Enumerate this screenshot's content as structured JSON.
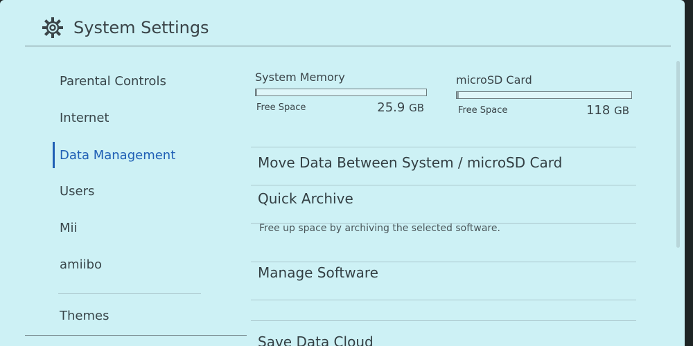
{
  "header": {
    "title": "System Settings",
    "icon": "gear-icon"
  },
  "sidebar": {
    "items": [
      {
        "label": "Parental Controls"
      },
      {
        "label": "Internet"
      },
      {
        "label": "Data Management"
      },
      {
        "label": "Users"
      },
      {
        "label": "Mii"
      },
      {
        "label": "amiibo"
      },
      {
        "label": "Themes"
      }
    ],
    "active_index": 2
  },
  "storage": {
    "system": {
      "title": "System Memory",
      "free_label": "Free Space",
      "free_value": "25.9",
      "free_unit": "GB"
    },
    "sd": {
      "title": "microSD Card",
      "free_label": "Free Space",
      "free_value": "118",
      "free_unit": "GB"
    }
  },
  "menu": {
    "move_data": "Move Data Between System / microSD Card",
    "quick_archive": "Quick Archive",
    "quick_archive_desc": "Free up space by archiving the selected software.",
    "manage_software": "Manage Software",
    "save_data_cloud": "Save Data Cloud"
  },
  "colors": {
    "background": "#cdf1f5",
    "accent": "#1f5fb5",
    "text": "#39464a"
  }
}
